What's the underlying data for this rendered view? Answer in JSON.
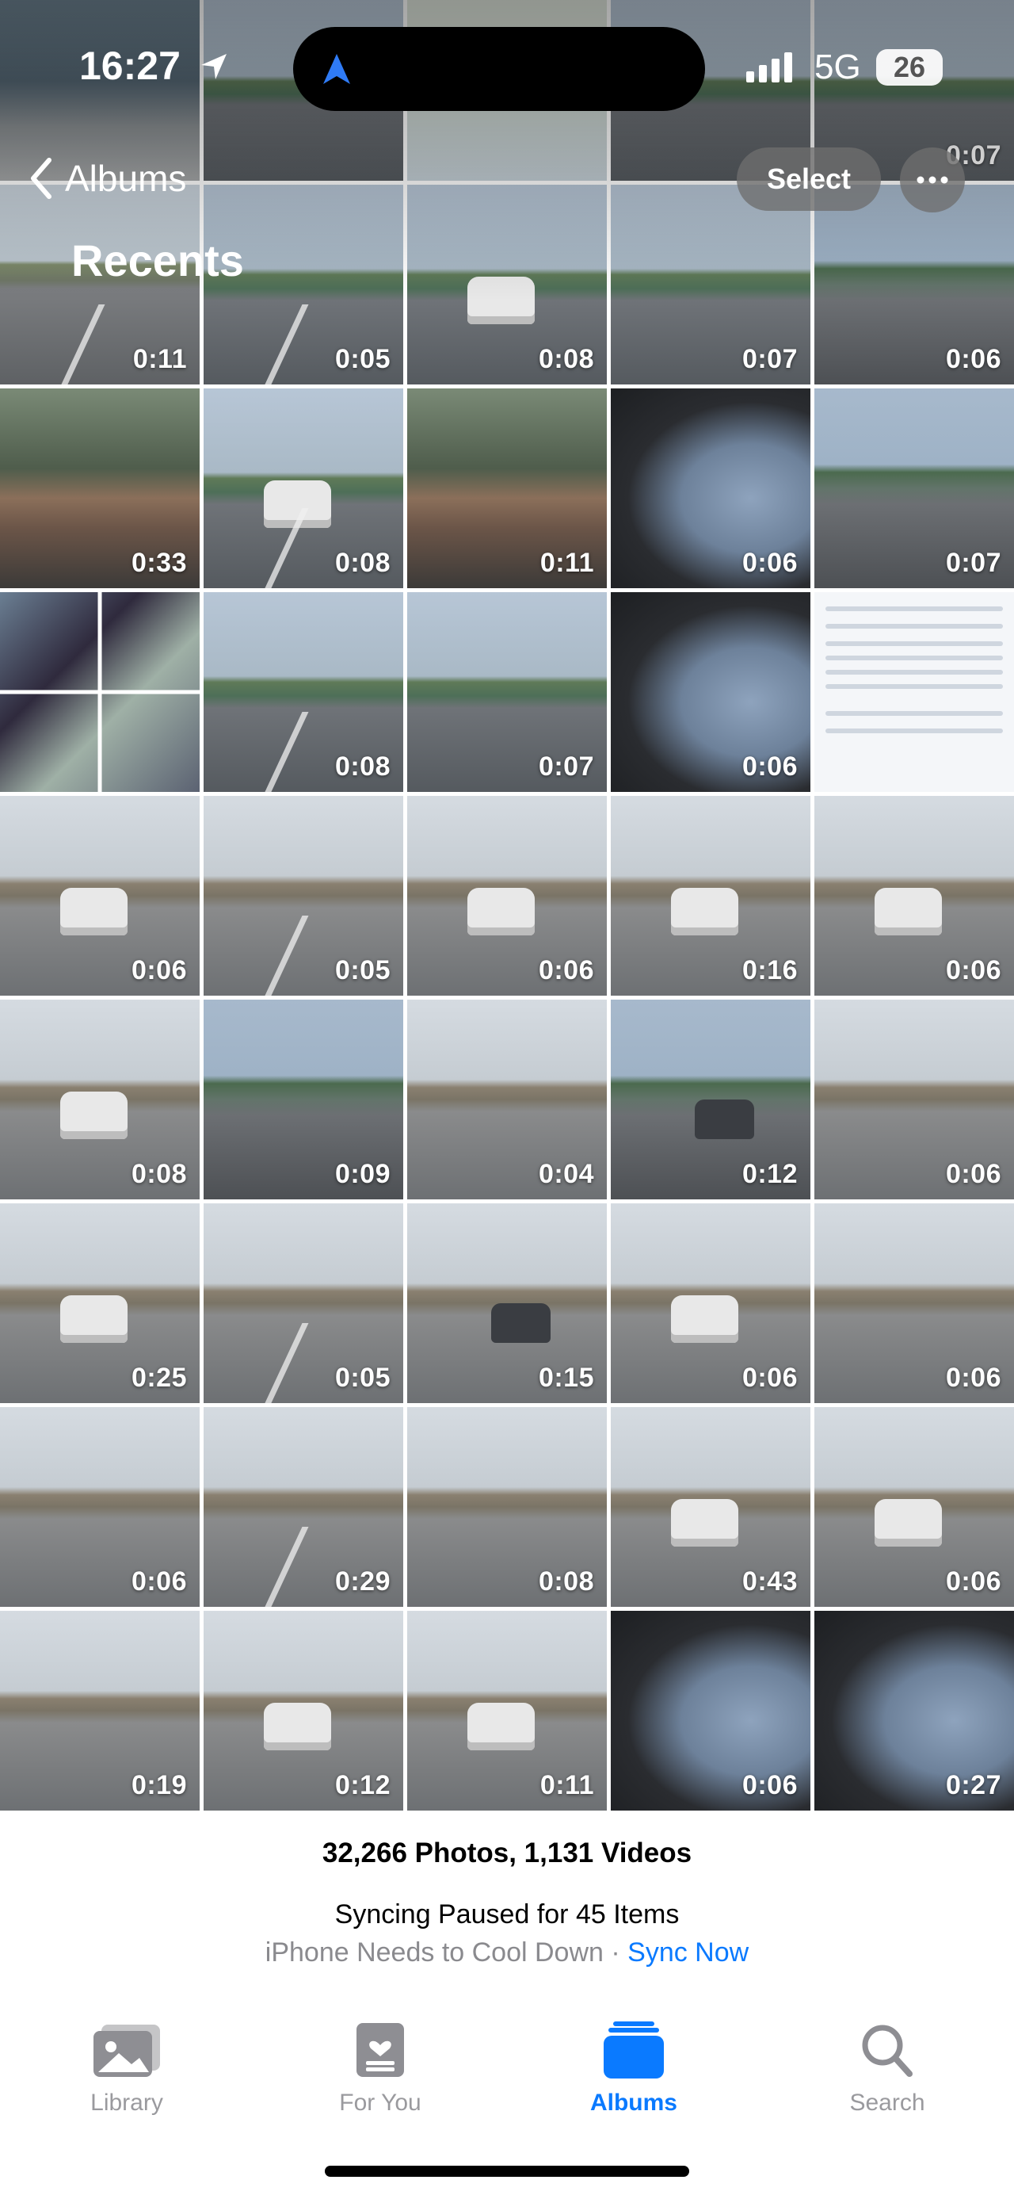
{
  "status_bar": {
    "time": "16:27",
    "network": "5G",
    "battery": "26"
  },
  "header": {
    "back_label": "Albums",
    "title": "Recents",
    "select_label": "Select"
  },
  "grid": {
    "durations": [
      "",
      "",
      "",
      "",
      "0:07",
      "0:11",
      "0:05",
      "0:08",
      "0:07",
      "0:06",
      "0:33",
      "0:08",
      "0:11",
      "0:06",
      "0:07",
      "",
      "0:08",
      "0:07",
      "0:06",
      "",
      "0:06",
      "0:05",
      "0:06",
      "0:16",
      "0:06",
      "0:08",
      "0:09",
      "0:04",
      "0:12",
      "0:06",
      "0:25",
      "0:05",
      "0:15",
      "0:06",
      "0:06",
      "0:06",
      "0:29",
      "0:08",
      "0:43",
      "0:06",
      "0:19",
      "0:12",
      "0:11",
      "0:06",
      "0:27"
    ]
  },
  "summary": {
    "counts": "32,266 Photos, 1,131 Videos",
    "sync_status": "Syncing Paused for 45 Items",
    "cool_down": "iPhone Needs to Cool Down · ",
    "sync_now": "Sync Now"
  },
  "tabs": [
    {
      "label": "Library",
      "icon": "photo-icon",
      "active": false
    },
    {
      "label": "For You",
      "icon": "memories-icon",
      "active": false
    },
    {
      "label": "Albums",
      "icon": "albums-icon",
      "active": true
    },
    {
      "label": "Search",
      "icon": "search-icon",
      "active": false
    }
  ],
  "colors": {
    "accent": "#0a7aff",
    "inactive_tab": "#9a9a9e"
  }
}
